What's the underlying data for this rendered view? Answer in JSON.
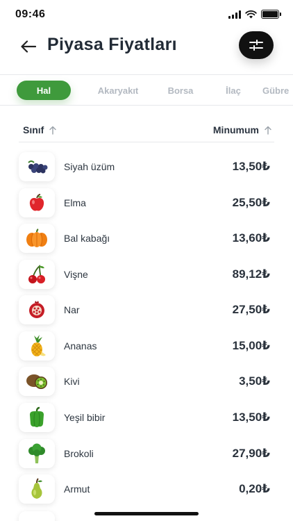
{
  "status_bar": {
    "time": "09:46"
  },
  "header": {
    "title": "Piyasa Fiyatları"
  },
  "tabs": [
    {
      "label": "Hal",
      "active": true
    },
    {
      "label": "Akaryakıt",
      "active": false
    },
    {
      "label": "Borsa",
      "active": false
    },
    {
      "label": "İlaç",
      "active": false
    },
    {
      "label": "Gübre",
      "active": false
    }
  ],
  "table": {
    "col_class": "Sınıf",
    "col_min": "Minumum",
    "rows": [
      {
        "name": "Siyah üzüm",
        "price": "13,50₺",
        "icon": "black-grape-icon"
      },
      {
        "name": "Elma",
        "price": "25,50₺",
        "icon": "apple-icon"
      },
      {
        "name": "Bal kabağı",
        "price": "13,60₺",
        "icon": "pumpkin-icon"
      },
      {
        "name": "Vişne",
        "price": "89,12₺",
        "icon": "cherry-icon"
      },
      {
        "name": "Nar",
        "price": "27,50₺",
        "icon": "pomegranate-icon"
      },
      {
        "name": "Ananas",
        "price": "15,00₺",
        "icon": "pineapple-icon"
      },
      {
        "name": "Kivi",
        "price": "3,50₺",
        "icon": "kiwi-icon"
      },
      {
        "name": "Yeşil bibir",
        "price": "13,50₺",
        "icon": "green-pepper-icon"
      },
      {
        "name": "Brokoli",
        "price": "27,90₺",
        "icon": "broccoli-icon"
      },
      {
        "name": "Armut",
        "price": "0,20₺",
        "icon": "pear-icon"
      }
    ]
  },
  "colors": {
    "accent": "#3f9a3c",
    "title": "#222b36",
    "muted_tab": "#b3b9c1"
  }
}
